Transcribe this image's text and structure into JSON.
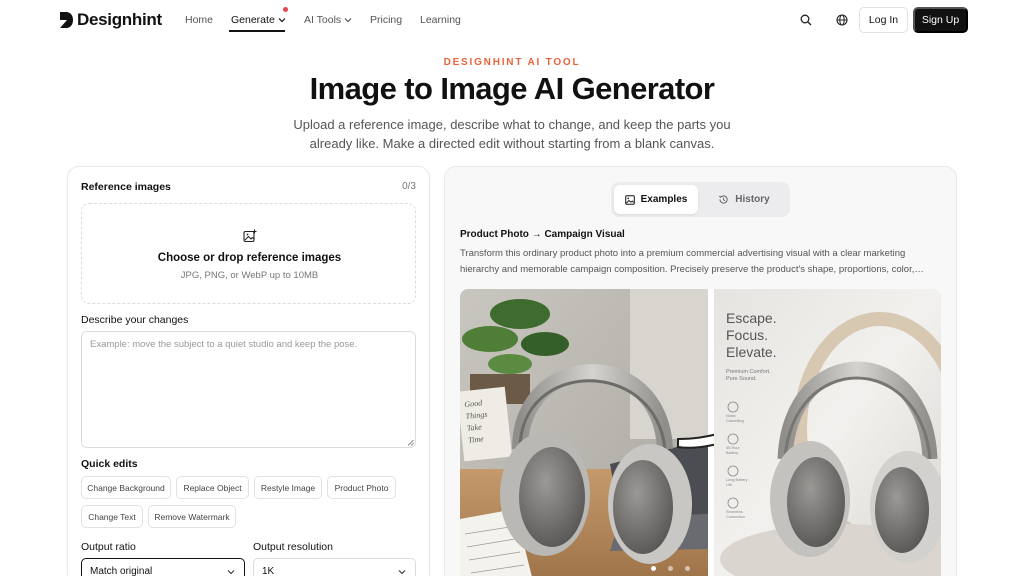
{
  "brand": {
    "name": "Designhint"
  },
  "nav": {
    "items": [
      {
        "label": "Home"
      },
      {
        "label": "Generate"
      },
      {
        "label": "AI Tools"
      },
      {
        "label": "Pricing"
      },
      {
        "label": "Learning"
      }
    ],
    "login_label": "Log In",
    "signup_label": "Sign Up"
  },
  "hero": {
    "eyebrow": "DESIGNHINT AI TOOL",
    "title": "Image to Image AI Generator",
    "subtitle": "Upload a reference image, describe what to change, and keep the parts you already like. Make a directed edit without starting from a blank canvas."
  },
  "form": {
    "reference_label": "Reference images",
    "reference_count": "0/3",
    "dropzone_title": "Choose or drop reference images",
    "dropzone_sub": "JPG, PNG, or WebP up to 10MB",
    "describe_label": "Describe your changes",
    "describe_placeholder": "Example: move the subject to a quiet studio and keep the pose.",
    "quick_edits_label": "Quick edits",
    "quick_edits": [
      "Change Background",
      "Replace Object",
      "Restyle Image",
      "Product Photo",
      "Change Text",
      "Remove Watermark"
    ],
    "ratio_label": "Output ratio",
    "ratio_value": "Match original",
    "resolution_label": "Output resolution",
    "resolution_value": "1K"
  },
  "examples": {
    "tabs": [
      {
        "label": "Examples"
      },
      {
        "label": "History"
      }
    ],
    "active_tab": "Examples",
    "title": "Product Photo → Campaign Visual",
    "description": "Transform this ordinary product photo into a premium commercial advertising visual with a clear marketing hierarchy and memorable campaign composition. Precisely preserve the product's shape, proportions, color, packaging, and details.",
    "before_note": {
      "line1": "Good",
      "line2": "Things",
      "line3": "Take",
      "line4": "Time"
    },
    "after_ad": {
      "headline": [
        "Escape.",
        "Focus.",
        "Elevate."
      ],
      "tagline": [
        "Premium Comfort.",
        "Pure Sound."
      ],
      "features": [
        {
          "l1": "Noise",
          "l2": "Cancelling"
        },
        {
          "l1": "40-Hour",
          "l2": "Battery"
        },
        {
          "l1": "Long Battery",
          "l2": "Life"
        },
        {
          "l1": "Seamless",
          "l2": "Connection"
        }
      ]
    },
    "slides": 3,
    "active_slide": 0,
    "colors": {
      "accent": "#e8643c",
      "dark": "#111111"
    }
  }
}
